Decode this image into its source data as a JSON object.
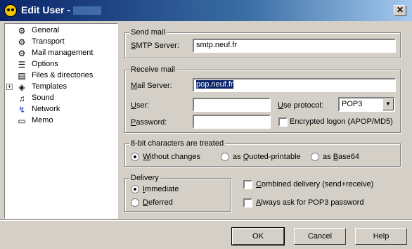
{
  "window": {
    "title": "Edit User -"
  },
  "tree": {
    "items": [
      {
        "label": "General",
        "icon": "gear-person-icon",
        "glyph": "⚙"
      },
      {
        "label": "Transport",
        "icon": "gear-icon",
        "glyph": "⚙"
      },
      {
        "label": "Mail management",
        "icon": "gear-icon",
        "glyph": "⚙"
      },
      {
        "label": "Options",
        "icon": "checklist-icon",
        "glyph": "☰"
      },
      {
        "label": "Files & directories",
        "icon": "files-icon",
        "glyph": "▤"
      },
      {
        "label": "Templates",
        "icon": "templates-icon",
        "glyph": "◈"
      },
      {
        "label": "Sound",
        "icon": "music-note-icon",
        "glyph": "♫"
      },
      {
        "label": "Network",
        "icon": "network-icon",
        "glyph": "↯"
      },
      {
        "label": "Memo",
        "icon": "memo-icon",
        "glyph": "▭"
      }
    ]
  },
  "send_mail": {
    "title": "Send mail",
    "smtp_label": "SMTP Server:",
    "smtp_value": "smtp.neuf.fr"
  },
  "receive_mail": {
    "title": "Receive mail",
    "server_label": "Mail Server:",
    "server_value": "pop.neuf.fr",
    "user_label": "User:",
    "user_value": "",
    "password_label": "Password:",
    "password_value": "",
    "protocol_label": "Use protocol:",
    "protocol_value": "POP3",
    "encrypted_label": "Encrypted logon (APOP/MD5)"
  },
  "eight_bit": {
    "title": "8-bit characters are treated",
    "options": [
      "Without changes",
      "as Quoted-printable",
      "as Base64"
    ],
    "selected": "Without changes"
  },
  "delivery": {
    "title": "Delivery",
    "options": [
      "Immediate",
      "Deferred"
    ],
    "selected": "Immediate",
    "combined_label": "Combined delivery (send+receive)",
    "always_ask_label": "Always ask for POP3 password"
  },
  "buttons": {
    "ok": "OK",
    "cancel": "Cancel",
    "help": "Help"
  },
  "colors": {
    "titlebar": "#0a246a",
    "face": "#d4d0c8",
    "selection": "#0a246a"
  }
}
